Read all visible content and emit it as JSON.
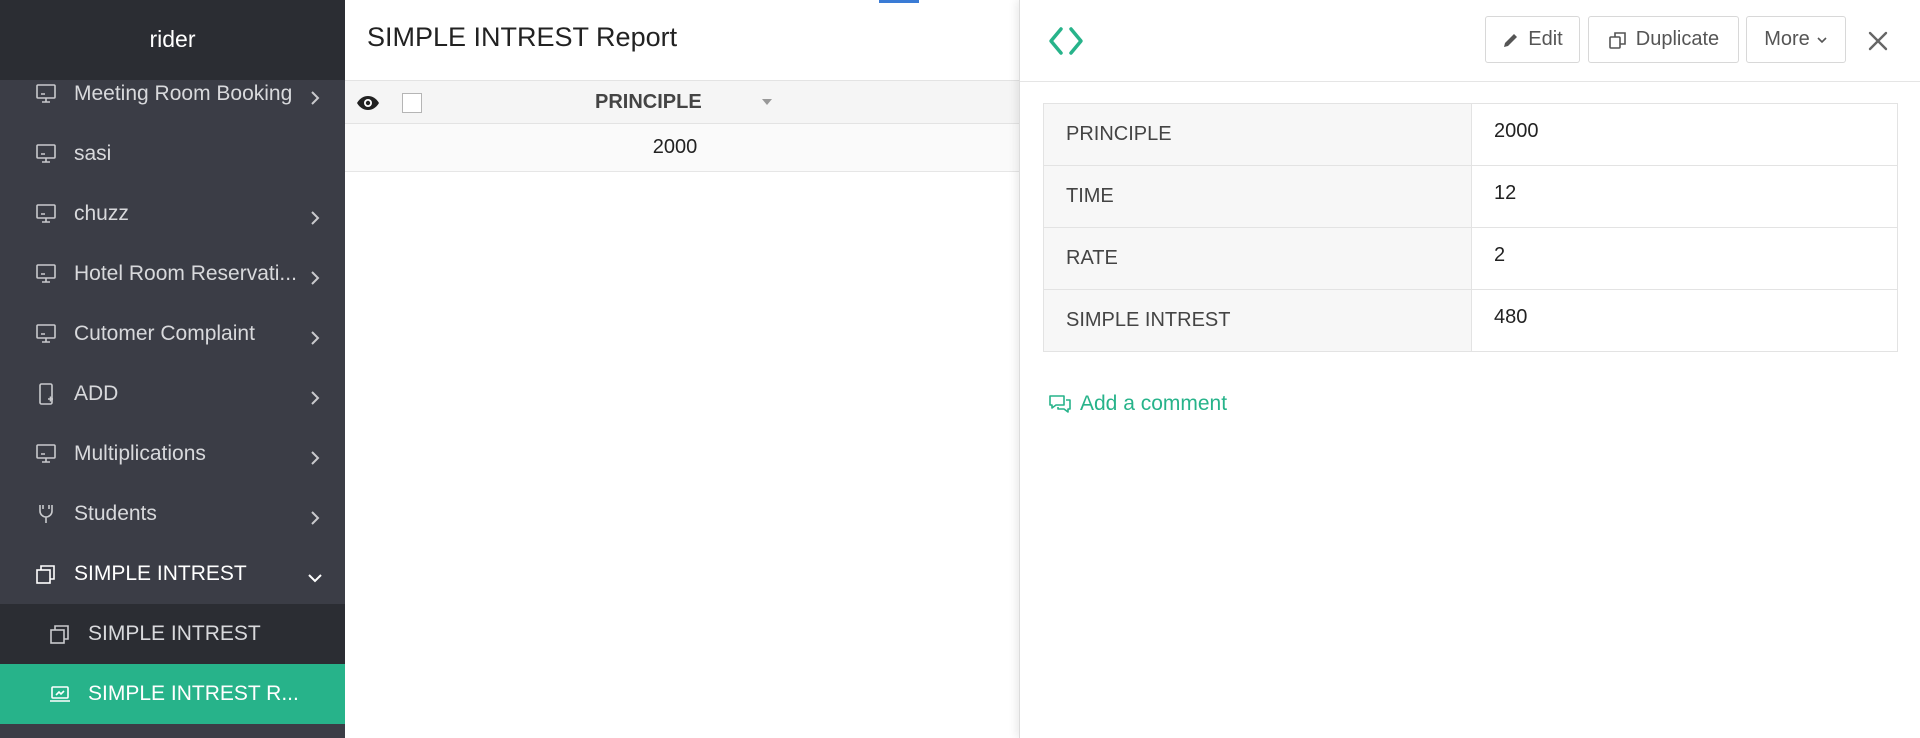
{
  "sidebar": {
    "app_name": "rider",
    "items": [
      {
        "label": "Meeting Room Booking",
        "icon": "report-icon",
        "chevron": "right"
      },
      {
        "label": "sasi",
        "icon": "report-icon",
        "chevron": ""
      },
      {
        "label": "chuzz",
        "icon": "report-icon",
        "chevron": "right"
      },
      {
        "label": "Hotel Room Reservati...",
        "icon": "report-icon",
        "chevron": "right"
      },
      {
        "label": "Cutomer Complaint",
        "icon": "report-icon",
        "chevron": "right"
      },
      {
        "label": "ADD",
        "icon": "mobile-add-icon",
        "chevron": "right"
      },
      {
        "label": "Multiplications",
        "icon": "report-icon",
        "chevron": "right"
      },
      {
        "label": "Students",
        "icon": "hierarchy-icon",
        "chevron": "right"
      },
      {
        "label": "SIMPLE INTREST",
        "icon": "forms-icon",
        "chevron": "down"
      }
    ],
    "sub_items": [
      {
        "label": "SIMPLE INTREST",
        "icon": "forms-icon"
      },
      {
        "label": "SIMPLE INTREST R...",
        "icon": "chart-report-icon"
      }
    ]
  },
  "report": {
    "title": "SIMPLE INTREST Report",
    "column": "PRINCIPLE",
    "rows": [
      "2000"
    ]
  },
  "detail": {
    "buttons": {
      "edit": "Edit",
      "duplicate": "Duplicate",
      "more": "More"
    },
    "fields": [
      {
        "label": "PRINCIPLE",
        "value": "2000"
      },
      {
        "label": "TIME",
        "value": "12"
      },
      {
        "label": "RATE",
        "value": "2"
      },
      {
        "label": "SIMPLE INTREST",
        "value": "480"
      }
    ],
    "add_comment": "Add a comment"
  },
  "colors": {
    "accent": "#27b38a",
    "sidebar_bg": "#3b3d46",
    "sidebar_dark": "#2b2d33"
  }
}
